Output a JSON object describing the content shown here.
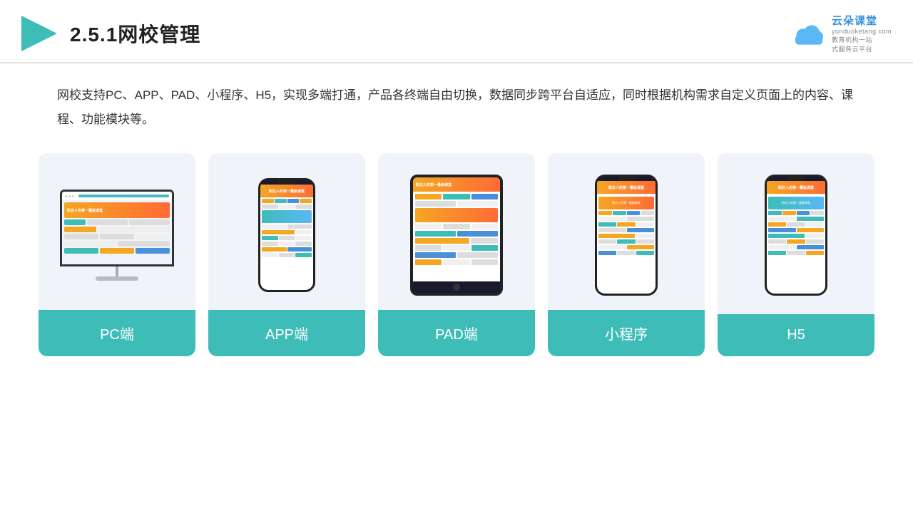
{
  "header": {
    "title": "2.5.1网校管理",
    "logo_main": "云朵课堂",
    "logo_url": "yunduoketang.com",
    "logo_sub1": "教育机构一站",
    "logo_sub2": "式服务云平台"
  },
  "description": {
    "text": "网校支持PC、APP、PAD、小程序、H5，实现多端打通，产品各终端自由切换，数据同步跨平台自适应，同时根据机构需求自定义页面上的内容、课程、功能模块等。"
  },
  "cards": [
    {
      "id": "pc",
      "label": "PC端"
    },
    {
      "id": "app",
      "label": "APP端"
    },
    {
      "id": "pad",
      "label": "PAD端"
    },
    {
      "id": "miniprogram",
      "label": "小程序"
    },
    {
      "id": "h5",
      "label": "H5"
    }
  ],
  "accent_color": "#3dbcb8"
}
